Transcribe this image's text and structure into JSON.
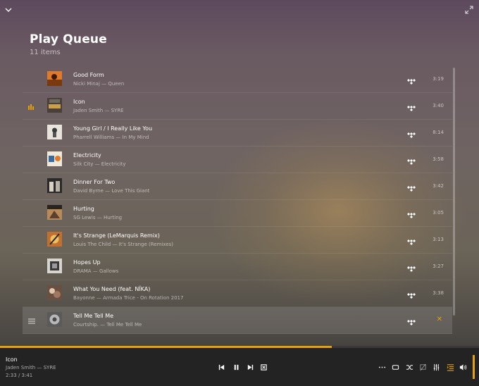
{
  "header": {
    "title": "Play Queue",
    "count": "11 items"
  },
  "queue": [
    {
      "title": "Good Form",
      "subtitle": "Nicki Minaj — Queen",
      "duration": "3:19",
      "art": "#e07a2a"
    },
    {
      "title": "Icon",
      "subtitle": "Jaden Smith — SYRE",
      "duration": "3:40",
      "art": "#8a6b3a",
      "state": "playing"
    },
    {
      "title": "Young Girl / I Really Like You",
      "subtitle": "Pharrell Williams — In My Mind",
      "duration": "8:14",
      "art": "#e8e4dc"
    },
    {
      "title": "Electricity",
      "subtitle": "Silk City — Electricity",
      "duration": "3:58",
      "art": "#f0e8d8"
    },
    {
      "title": "Dinner For Two",
      "subtitle": "David Byrne — Love This Giant",
      "duration": "3:42",
      "art": "#2a2a2a"
    },
    {
      "title": "Hurting",
      "subtitle": "SG Lewis — Hurting",
      "duration": "3:05",
      "art": "#b78a58"
    },
    {
      "title": "It's Strange (LeMarquis Remix)",
      "subtitle": "Louis The Child — It's Strange (Remixes)",
      "duration": "3:13",
      "art": "#c07030"
    },
    {
      "title": "Hopes Up",
      "subtitle": "DRAMA — Gallows",
      "duration": "3:27",
      "art": "#d8d4ce"
    },
    {
      "title": "What You Need (feat. NÏKA)",
      "subtitle": "Bayonne — Armada Trice - On Rotation 2017",
      "duration": "3:38",
      "art": "#6a5040"
    },
    {
      "title": "Tell Me Tell Me",
      "subtitle": "Courtship. — Tell Me Tell Me",
      "duration": "",
      "art": "#8a8a8a",
      "state": "hover"
    }
  ],
  "now_playing": {
    "title": "Icon",
    "artist": "Jaden Smith — SYRE",
    "time": "2:33 / 3:41",
    "progress": 0.693
  },
  "colors": {
    "accent": "#e5a00d",
    "player_bg": "#232323"
  },
  "icons": {
    "collapse": "chevron-down-icon",
    "fullscreen": "expand-icon",
    "source": "tidal-icon",
    "controls": [
      "previous-icon",
      "pause-icon",
      "next-icon",
      "stop-icon"
    ],
    "right_controls": [
      "more-icon",
      "repeat-icon",
      "shuffle-icon",
      "cast-icon",
      "equalizer-icon",
      "queue-icon",
      "volume-icon"
    ]
  }
}
